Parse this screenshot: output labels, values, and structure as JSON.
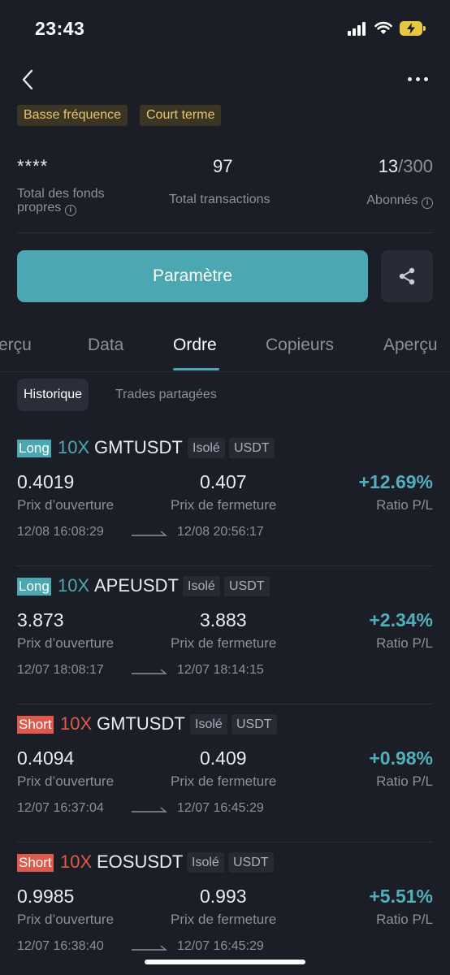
{
  "status_bar": {
    "time": "23:43"
  },
  "tags": [
    "Basse fréquence",
    "Court terme"
  ],
  "stats": {
    "equity": {
      "value": "****",
      "label_line1": "Total des fonds",
      "label_line2": "propres"
    },
    "transactions": {
      "value": "97",
      "label": "Total transactions"
    },
    "followers": {
      "current": "13",
      "max": "/300",
      "label": "Abonnés"
    }
  },
  "actions": {
    "main_button": "Paramètre"
  },
  "tabs": [
    "erçu",
    "Data",
    "Ordre",
    "Copieurs",
    "Aperçu"
  ],
  "subtabs": [
    "Historique",
    "Trades partagées"
  ],
  "labels": {
    "open": "Prix d’ouverture",
    "close": "Prix de fermeture",
    "ratio": "Ratio P/L"
  },
  "trades": [
    {
      "side": "Long",
      "leverage": "10X",
      "pair": "GMTUSDT",
      "margin": "Isolé",
      "settle": "USDT",
      "open_price": "0.4019",
      "close_price": "0.407",
      "pl": "+12.69%",
      "open_time": "12/08 16:08:29",
      "close_time": "12/08 20:56:17"
    },
    {
      "side": "Long",
      "leverage": "10X",
      "pair": "APEUSDT",
      "margin": "Isolé",
      "settle": "USDT",
      "open_price": "3.873",
      "close_price": "3.883",
      "pl": "+2.34%",
      "open_time": "12/07 18:08:17",
      "close_time": "12/07 18:14:15"
    },
    {
      "side": "Short",
      "leverage": "10X",
      "pair": "GMTUSDT",
      "margin": "Isolé",
      "settle": "USDT",
      "open_price": "0.4094",
      "close_price": "0.409",
      "pl": "+0.98%",
      "open_time": "12/07 16:37:04",
      "close_time": "12/07 16:45:29"
    },
    {
      "side": "Short",
      "leverage": "10X",
      "pair": "EOSUSDT",
      "margin": "Isolé",
      "settle": "USDT",
      "open_price": "0.9985",
      "close_price": "0.993",
      "pl": "+5.51%",
      "open_time": "12/07 16:38:40",
      "close_time": "12/07 16:45:29"
    }
  ],
  "colors": {
    "accent": "#4ba8b2",
    "short": "#e05a4c",
    "tag_text": "#e8c46e",
    "background": "#1b1e26"
  },
  "icons": [
    "back-chevron-icon",
    "more-dots-icon",
    "info-icon",
    "share-icon",
    "arrow-right-icon"
  ]
}
